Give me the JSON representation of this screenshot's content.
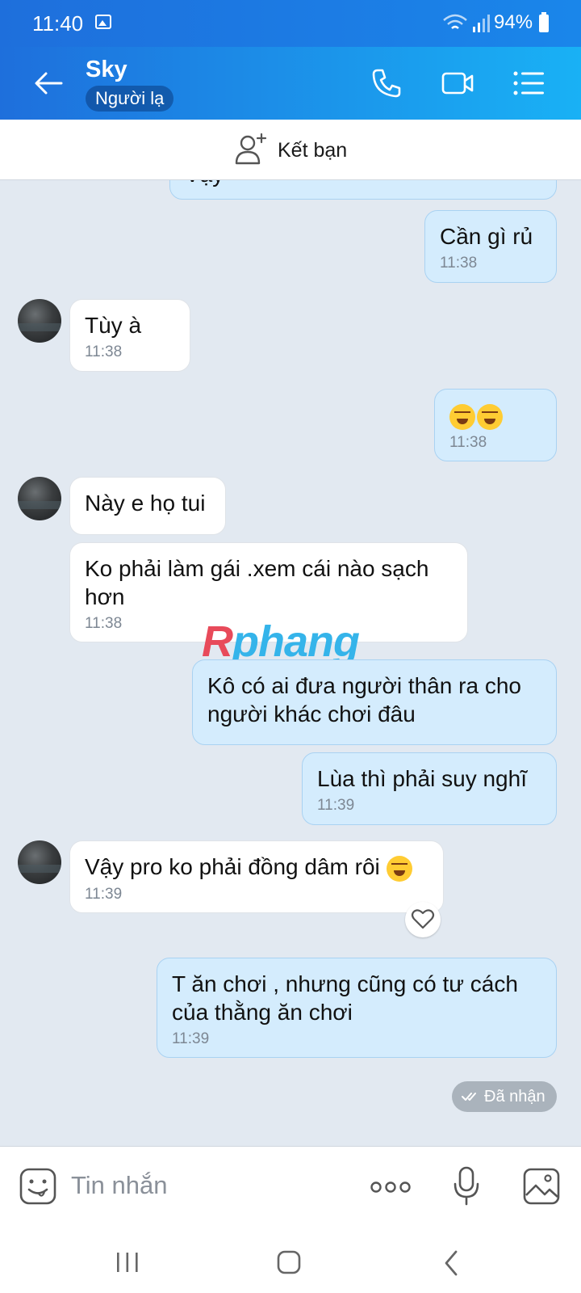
{
  "status": {
    "time": "11:40",
    "battery": "94%"
  },
  "header": {
    "name": "Sky",
    "badge": "Người lạ"
  },
  "add_friend": {
    "label": "Kết bạn"
  },
  "messages": [
    {
      "text": "Vậy",
      "time": ""
    },
    {
      "text": "Cần gì rủ",
      "time": "11:38"
    },
    {
      "text": "Tùy à",
      "time": "11:38"
    },
    {
      "text": "",
      "emoji": "rolling-laughing-emoji x2",
      "time": "11:38"
    },
    {
      "text": "Này e họ tui",
      "time": ""
    },
    {
      "text": "Ko phải làm gái .xem cái nào sạch hơn",
      "time": "11:38"
    },
    {
      "text": "Kô có ai đưa người thân ra cho người khác chơi đâu",
      "time": ""
    },
    {
      "text": "Lùa thì phải suy nghĩ",
      "time": "11:39"
    },
    {
      "text": "Vậy pro ko phải đồng dâm rôi",
      "time": "11:39"
    },
    {
      "text": "T ăn chơi , nhưng cũng có tư cách của thằng ăn chơi",
      "time": "11:39"
    }
  ],
  "received_label": "Đã nhận",
  "watermark": {
    "first": "R",
    "rest": "phang"
  },
  "input": {
    "placeholder": "Tin nhắn"
  },
  "colors": {
    "primary": "#1e6fdc",
    "bubble_out": "#d4ecfd",
    "bubble_in": "#ffffff",
    "chat_bg": "#e2e9f1"
  }
}
